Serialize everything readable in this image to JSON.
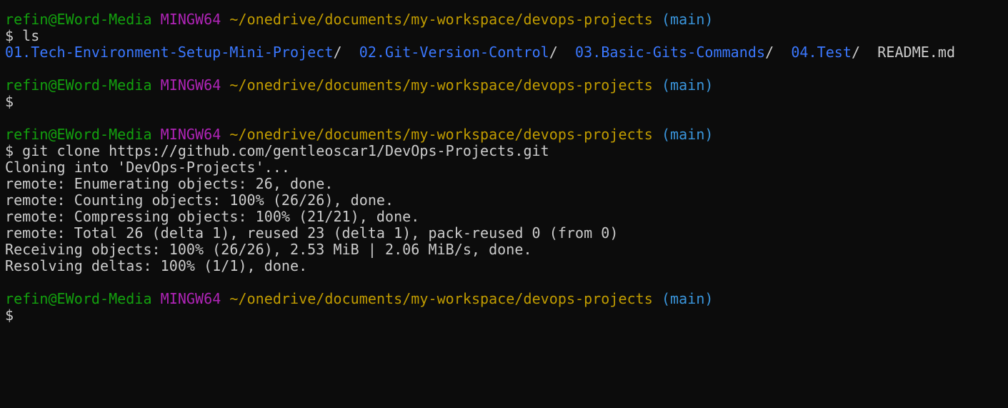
{
  "terminal": {
    "blocks": [
      {
        "prompt": {
          "user": "refin@EWord-Media",
          "system": "MINGW64",
          "path": "~/onedrive/documents/my-workspace/devops-projects",
          "branch": "(main)"
        },
        "command": "$ ls",
        "listing": [
          {
            "name": "01.Tech-Environment-Setup-Mini-Project",
            "suffix": "/"
          },
          {
            "name": "02.Git-Version-Control",
            "suffix": "/"
          },
          {
            "name": "03.Basic-Gits-Commands",
            "suffix": "/"
          },
          {
            "name": "04.Test",
            "suffix": "/"
          },
          {
            "name": "README.md",
            "suffix": ""
          }
        ]
      },
      {
        "prompt": {
          "user": "refin@EWord-Media",
          "system": "MINGW64",
          "path": "~/onedrive/documents/my-workspace/devops-projects",
          "branch": "(main)"
        },
        "command": "$"
      },
      {
        "prompt": {
          "user": "refin@EWord-Media",
          "system": "MINGW64",
          "path": "~/onedrive/documents/my-workspace/devops-projects",
          "branch": "(main)"
        },
        "command": "$ git clone https://github.com/gentleoscar1/DevOps-Projects.git",
        "output": [
          "Cloning into 'DevOps-Projects'...",
          "remote: Enumerating objects: 26, done.",
          "remote: Counting objects: 100% (26/26), done.",
          "remote: Compressing objects: 100% (21/21), done.",
          "remote: Total 26 (delta 1), reused 23 (delta 1), pack-reused 0 (from 0)",
          "Receiving objects: 100% (26/26), 2.53 MiB | 2.06 MiB/s, done.",
          "Resolving deltas: 100% (1/1), done."
        ]
      },
      {
        "prompt": {
          "user": "refin@EWord-Media",
          "system": "MINGW64",
          "path": "~/onedrive/documents/my-workspace/devops-projects",
          "branch": "(main)"
        },
        "command": "$"
      }
    ],
    "colors": {
      "background": "#0c0c0c",
      "text": "#cccccc",
      "user": "#13a10e",
      "system": "#b024b7",
      "path": "#c19c00",
      "branch": "#3a96dd",
      "directory": "#3b78ff"
    }
  }
}
